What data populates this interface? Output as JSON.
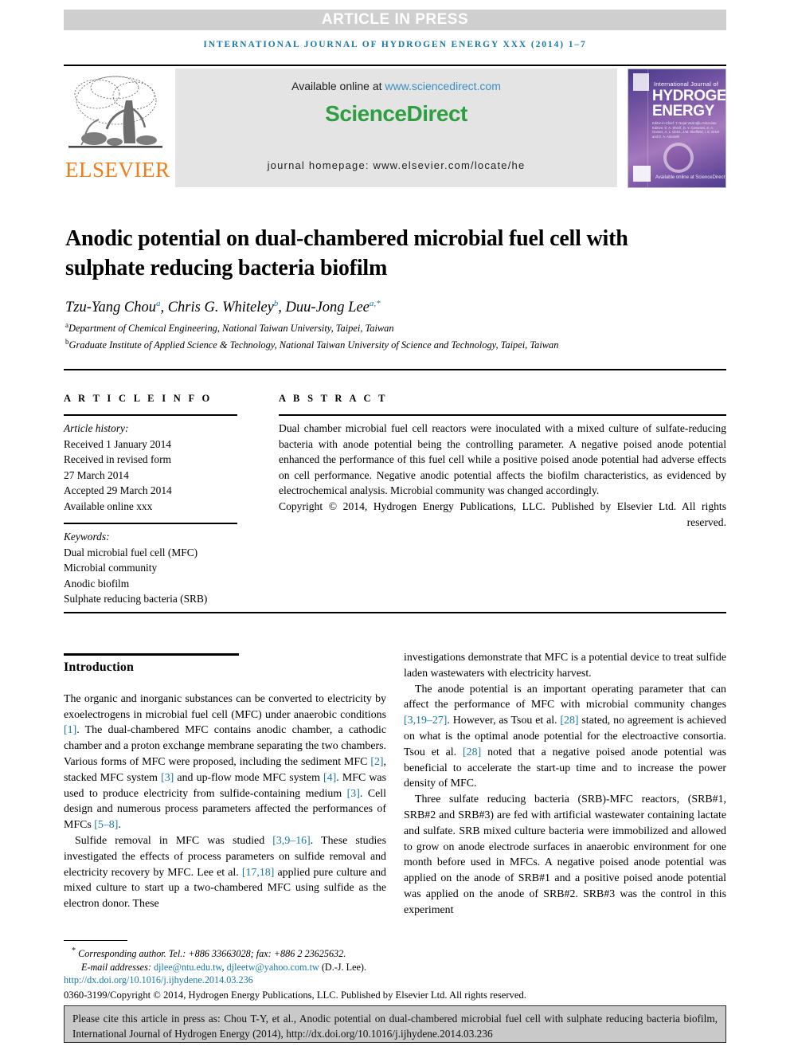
{
  "banner": {
    "article_in_press": "ARTICLE IN PRESS"
  },
  "running_head": "international journal of hydrogen energy xxx (2014) 1–7",
  "masthead": {
    "publisher_name": "ELSEVIER",
    "available_online_prefix": "Available online at ",
    "sciencedirect_url": "www.sciencedirect.com",
    "sciencedirect_logo": "ScienceDirect",
    "journal_homepage": "journal homepage: www.elsevier.com/locate/he",
    "cover": {
      "supertitle": "International Journal of",
      "line1": "HYDROGEN",
      "line2": "ENERGY",
      "editors": "Editor-in-Chief: T. Nejat Veziroğlu   Associate Editors: S. A. Sherif, D. Y. Goswami, S. A. Gomez, A. L. Dicks, J.W. Sheffield, I. E. Ersel and D. A. Antonelli",
      "sciencedirect": "Available online at ScienceDirect"
    }
  },
  "article": {
    "title": "Anodic potential on dual-chambered microbial fuel cell with sulphate reducing bacteria biofilm",
    "authors": [
      {
        "name": "Tzu-Yang Chou",
        "sup": "a"
      },
      {
        "name": "Chris G. Whiteley",
        "sup": "b"
      },
      {
        "name": "Duu-Jong Lee",
        "sup": "a,*"
      }
    ],
    "affiliations": [
      {
        "marker": "a",
        "text": "Department of Chemical Engineering, National Taiwan University, Taipei, Taiwan"
      },
      {
        "marker": "b",
        "text": "Graduate Institute of Applied Science & Technology, National Taiwan University of Science and Technology, Taipei, Taiwan"
      }
    ]
  },
  "article_info": {
    "heading": "A R T I C L E   I N F O",
    "history_label": "Article history:",
    "history_lines": [
      "Received 1 January 2014",
      "Received in revised form",
      "27 March 2014",
      "Accepted 29 March 2014",
      "Available online xxx"
    ],
    "keywords_label": "Keywords:",
    "keywords": [
      "Dual microbial fuel cell (MFC)",
      "Microbial community",
      "Anodic biofilm",
      "Sulphate reducing bacteria (SRB)"
    ]
  },
  "abstract": {
    "heading": "A B S T R A C T",
    "text": "Dual chamber microbial fuel cell reactors were inoculated with a mixed culture of sulfate-reducing bacteria with anode potential being the controlling parameter. A negative poised anode potential enhanced the performance of this fuel cell while a positive poised anode potential had adverse effects on cell performance. Negative anodic potential affects the biofilm characteristics, as evidenced by electrochemical analysis. Microbial community was changed accordingly.",
    "copyright": "Copyright © 2014, Hydrogen Energy Publications, LLC. Published by Elsevier Ltd. All rights reserved."
  },
  "body": {
    "intro_heading": "Introduction",
    "left_paragraphs": [
      "The organic and inorganic substances can be converted to electricity by exoelectrogens in microbial fuel cell (MFC) under anaerobic conditions [1]. The dual-chambered MFC contains anodic chamber, a cathodic chamber and a proton exchange membrane separating the two chambers. Various forms of MFC were proposed, including the sediment MFC [2], stacked MFC system [3] and up-flow mode MFC system [4]. MFC was used to produce electricity from sulfide-containing medium [3]. Cell design and numerous process parameters affected the performances of MFCs [5–8].",
      "Sulfide removal in MFC was studied [3,9–16]. These studies investigated the effects of process parameters on sulfide removal and electricity recovery by MFC. Lee et al. [17,18] applied pure culture and mixed culture to start up a two-chambered MFC using sulfide as the electron donor. These"
    ],
    "right_paragraphs": [
      "investigations demonstrate that MFC is a potential device to treat sulfide laden wastewaters with electricity harvest.",
      "The anode potential is an important operating parameter that can affect the performance of MFC with microbial community changes [3,19–27]. However, as Tsou et al. [28] stated, no agreement is achieved on what is the optimal anode potential for the electroactive consortia. Tsou et al. [28] noted that a negative poised anode potential was beneficial to accelerate the start-up time and to increase the power density of MFC.",
      "Three sulfate reducing bacteria (SRB)-MFC reactors, (SRB#1, SRB#2 and SRB#3) are fed with artificial wastewater containing lactate and sulfate. SRB mixed culture bacteria were immobilized and allowed to grow on anode electrode surfaces in anaerobic environment for one month before used in MFCs. A negative poised anode potential was applied on the anode of SRB#1 and a positive poised anode potential was applied on the anode of SRB#2. SRB#3 was the control in this experiment"
    ]
  },
  "footnotes": {
    "corresponding": "Corresponding author. Tel.: +886 33663028; fax: +886 2 23625632.",
    "corresponding_marker": "*",
    "email_label": "E-mail addresses:",
    "email1": "djlee@ntu.edu.tw",
    "email2": "djleetw@yahoo.com.tw",
    "email_owner": "(D.-J. Lee).",
    "doi": "http://dx.doi.org/10.1016/j.ijhydene.2014.03.236",
    "issn_line": "0360-3199/Copyright © 2014, Hydrogen Energy Publications, LLC. Published by Elsevier Ltd. All rights reserved."
  },
  "cite_box": {
    "text": "Please cite this article in press as: Chou T-Y, et al., Anodic potential on dual-chambered microbial fuel cell with sulphate reducing bacteria biofilm, International Journal of Hydrogen Energy (2014), http://dx.doi.org/10.1016/j.ijhydene.2014.03.236"
  },
  "colors": {
    "link_blue": "#1878a8",
    "sciencedirect_green": "#2f9e41",
    "elsevier_orange": "#f07d1a",
    "banner_gray": "#cfcfcf",
    "box_gray": "#e4e4e4",
    "cite_gray": "#c9c9c9"
  }
}
